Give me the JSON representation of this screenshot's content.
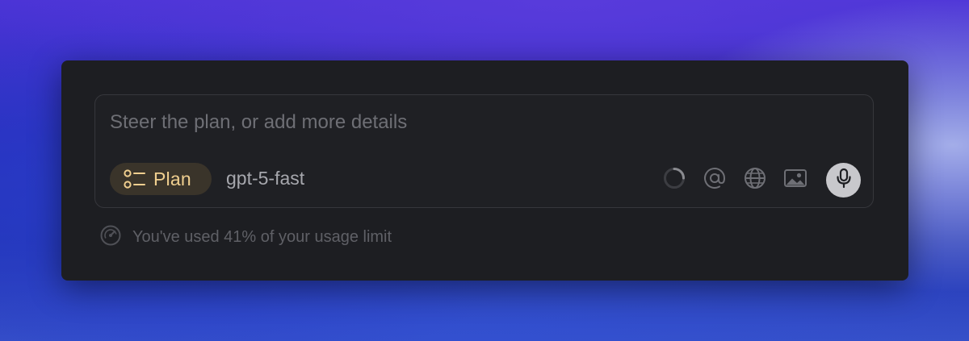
{
  "composer": {
    "placeholder": "Steer the plan, or add more details",
    "value": "",
    "mode_icon": "list-icon",
    "mode_label": "Plan",
    "model_label": "gpt-5-fast",
    "toolbar": {
      "icons": [
        "loading-spinner-icon",
        "at-sign-icon",
        "globe-icon",
        "image-icon",
        "microphone-icon"
      ]
    }
  },
  "usage": {
    "icon": "gauge-icon",
    "text": "You've used 41% of your usage limit",
    "percent": 41
  },
  "colors": {
    "panel": "#1d1e22",
    "mode_chip_bg": "#3a342a",
    "mode_chip_text": "#f0cf8f",
    "mic_button_bg": "#c8c8cc"
  }
}
